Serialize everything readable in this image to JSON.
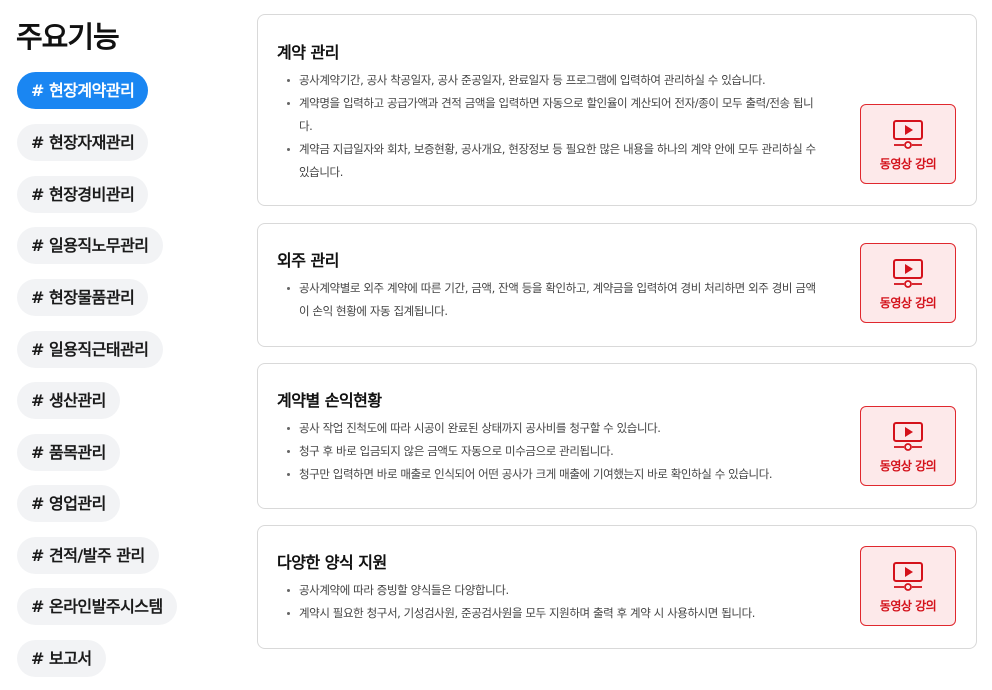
{
  "page_title": "주요기능",
  "nav": {
    "items": [
      {
        "label": "# 현장계약관리",
        "active": true
      },
      {
        "label": "# 현장자재관리"
      },
      {
        "label": "# 현장경비관리"
      },
      {
        "label": "# 일용직노무관리"
      },
      {
        "label": "# 현장물품관리"
      },
      {
        "label": "# 일용직근태관리"
      },
      {
        "label": "# 생산관리"
      },
      {
        "label": "# 품목관리"
      },
      {
        "label": "# 영업관리"
      },
      {
        "label": "# 견적/발주 관리"
      },
      {
        "label": "# 온라인발주시스템"
      },
      {
        "label": "# 보고서"
      }
    ]
  },
  "cards": [
    {
      "title": "계약 관리",
      "bullets": [
        "공사계약기간, 공사 착공일자, 공사 준공일자, 완료일자 등 프로그램에 입력하여 관리하실 수 있습니다.",
        "계약명을 입력하고 공급가액과 견적 금액을 입력하면 자동으로 할인율이 계산되어 전자/종이 모두 출력/전송 됩니다.",
        "계약금 지급일자와 회차, 보증현황, 공사개요, 현장정보 등 필요한 많은 내용을 하나의 계약 안에 모두 관리하실 수 있습니다."
      ],
      "button_label": "동영상 강의"
    },
    {
      "title": "외주 관리",
      "bullets": [
        "공사계약별로 외주 계약에 따른 기간, 금액, 잔액 등을 확인하고, 계약금을 입력하여 경비 처리하면 외주 경비 금액이 손익 현황에 자동 집계됩니다."
      ],
      "button_label": "동영상 강의"
    },
    {
      "title": "계약별 손익현황",
      "bullets": [
        "공사 작업 진척도에 따라 시공이 완료된 상태까지 공사비를 청구할 수 있습니다.",
        "청구 후 바로 입금되지 않은 금액도 자동으로 미수금으로 관리됩니다.",
        "청구만 입력하면 바로 매출로 인식되어 어떤 공사가 크게 매출에 기여했는지 바로 확인하실 수 있습니다."
      ],
      "button_label": "동영상 강의"
    },
    {
      "title": "다양한 양식 지원",
      "bullets": [
        "공사계약에 따라 증빙할 양식들은 다양합니다.",
        "계약시 필요한 청구서, 기성검사원, 준공검사원을 모두 지원하며 출력 후 계약 시 사용하시면 됩니다."
      ],
      "button_label": "동영상 강의"
    }
  ],
  "colors": {
    "active_pill": "#1a86f2",
    "pill_bg": "#f2f3f5",
    "video_border": "#e0282e",
    "video_bg": "#fde9ea",
    "video_text": "#d4121b"
  },
  "icons": {
    "video_button": "video-lecture-icon"
  }
}
